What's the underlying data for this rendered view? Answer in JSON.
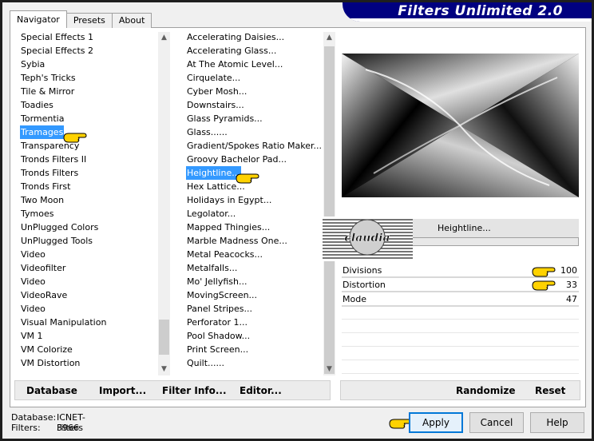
{
  "window": {
    "title": "Filters Unlimited 2.0"
  },
  "tabs": [
    {
      "label": "Navigator",
      "active": true
    },
    {
      "label": "Presets",
      "active": false
    },
    {
      "label": "About",
      "active": false
    }
  ],
  "categories": {
    "selected": "Tramages",
    "items": [
      "Special Effects 1",
      "Special Effects 2",
      "Sybia",
      "Teph's Tricks",
      "Tile & Mirror",
      "Toadies",
      "Tormentia",
      "Tramages",
      "Transparency",
      "Tronds Filters II",
      "Tronds Filters",
      "Tronds First",
      "Two Moon",
      "Tymoes",
      "UnPlugged Colors",
      "UnPlugged Tools",
      "Video",
      "Videofilter",
      "Video",
      "VideoRave",
      "Video",
      "Visual Manipulation",
      "VM 1",
      "VM Colorize",
      "VM Distortion"
    ]
  },
  "filters": {
    "selected": "Heightline...",
    "items": [
      "Accelerating Daisies...",
      "Accelerating Glass...",
      "At The Atomic Level...",
      "Cirquelate...",
      "Cyber Mosh...",
      "Downstairs...",
      "Glass Pyramids...",
      "Glass......",
      "Gradient/Spokes Ratio Maker...",
      "Groovy Bachelor Pad...",
      "Heightline...",
      "Hex Lattice...",
      "Holidays in Egypt...",
      "Legolator...",
      "Mapped Thingies...",
      "Marble Madness One...",
      "Metal Peacocks...",
      "Metalfalls...",
      "Mo' Jellyfish...",
      "MovingScreen...",
      "Panel Stripes...",
      "Perforator 1...",
      "Pool Shadow...",
      "Print Screen...",
      "Quilt......"
    ]
  },
  "current_filter": "Heightline...",
  "progress_value": 0,
  "parameters": [
    {
      "name": "Divisions",
      "value": "100"
    },
    {
      "name": "Distortion",
      "value": "33"
    },
    {
      "name": "Mode",
      "value": "47"
    }
  ],
  "toolbar_left": {
    "database": "Database",
    "import": "Import...",
    "filter_info": "Filter Info...",
    "editor": "Editor..."
  },
  "toolbar_right": {
    "randomize": "Randomize",
    "reset": "Reset"
  },
  "status": {
    "database_label": "Database:",
    "database_value": "ICNET-Filters",
    "filters_label": "Filters:",
    "filters_value": "3966"
  },
  "buttons": {
    "apply": "Apply",
    "cancel": "Cancel",
    "help": "Help"
  },
  "logo_text": "claudia",
  "colors": {
    "title_bg": "#000080",
    "selection": "#3399ff",
    "hand": "#ffd200",
    "default_button_border": "#0078d7"
  },
  "icons": {
    "pointer": "pointing-hand-icon"
  }
}
